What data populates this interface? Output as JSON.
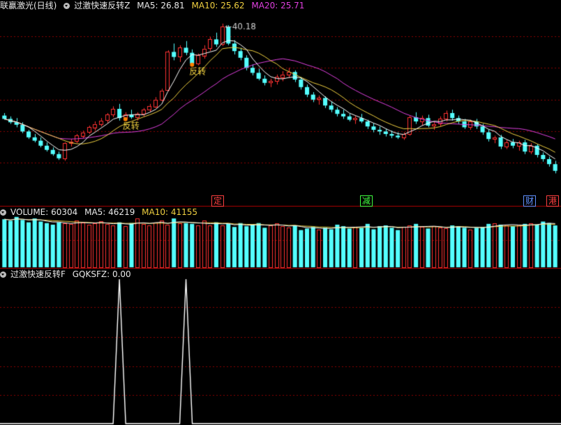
{
  "header": {
    "stock": "联赢激光(日线)",
    "indicator": "过激快速反转Z",
    "ma5": "MA5: 26.81",
    "ma10": "MA10: 25.62",
    "ma20": "MA20: 25.71"
  },
  "annotations": {
    "high": "40.18",
    "reversal1": "反转",
    "reversal2": "反转"
  },
  "event_tags": [
    {
      "label": "定",
      "color": "#ff4040"
    },
    {
      "label": "减",
      "color": "#40ff40"
    },
    {
      "label": "财",
      "color": "#6090ff"
    },
    {
      "label": "港",
      "color": "#ff4040"
    }
  ],
  "volume_header": {
    "volume": "VOLUME: 60304",
    "ma5": "MA5: 46219",
    "ma10": "MA10: 41155"
  },
  "osc_header": {
    "name": "过激快速反转F",
    "value": "GQKSFZ: 0.00"
  },
  "colors": {
    "up": "#ff3232",
    "down": "#54ffff",
    "ma5": "#ffffff",
    "ma10": "#f0d040",
    "ma20": "#e040e0",
    "grid": "#8b0000"
  },
  "chart_data": [
    {
      "type": "candlestick",
      "title": "联赢激光(日线)",
      "ylim": [
        20,
        41.5
      ],
      "high_label": 40.18,
      "ohlc": [
        [
          29.2,
          29.5,
          28.7,
          28.8
        ],
        [
          28.8,
          29.1,
          28.2,
          28.4
        ],
        [
          28.4,
          28.9,
          27.8,
          28.1
        ],
        [
          28.1,
          28.4,
          27.1,
          27.3
        ],
        [
          27.3,
          27.5,
          26.4,
          26.6
        ],
        [
          26.6,
          27.0,
          26.0,
          26.2
        ],
        [
          26.2,
          26.6,
          25.4,
          25.6
        ],
        [
          25.6,
          26.0,
          24.9,
          25.1
        ],
        [
          25.1,
          25.4,
          24.4,
          24.6
        ],
        [
          24.6,
          24.9,
          23.9,
          24.1
        ],
        [
          24.1,
          26.0,
          23.8,
          25.9
        ],
        [
          25.9,
          26.4,
          25.5,
          26.1
        ],
        [
          26.1,
          27.0,
          25.9,
          26.8
        ],
        [
          26.8,
          27.4,
          26.5,
          27.2
        ],
        [
          27.2,
          28.0,
          27.0,
          27.8
        ],
        [
          27.8,
          28.5,
          27.4,
          28.2
        ],
        [
          28.2,
          28.9,
          27.9,
          28.6
        ],
        [
          28.6,
          29.5,
          28.3,
          29.3
        ],
        [
          29.3,
          30.3,
          29.0,
          30.0
        ],
        [
          30.0,
          30.6,
          28.6,
          28.9
        ],
        [
          28.9,
          29.6,
          28.6,
          29.3
        ],
        [
          29.3,
          29.9,
          28.8,
          29.0
        ],
        [
          29.0,
          29.6,
          28.6,
          29.4
        ],
        [
          29.4,
          30.1,
          29.1,
          29.9
        ],
        [
          29.9,
          30.6,
          29.6,
          30.3
        ],
        [
          30.3,
          31.4,
          30.1,
          31.1
        ],
        [
          31.1,
          32.4,
          30.9,
          32.2
        ],
        [
          32.2,
          37.0,
          32.1,
          36.8
        ],
        [
          36.8,
          37.8,
          35.8,
          36.2
        ],
        [
          36.2,
          37.6,
          35.6,
          37.3
        ],
        [
          37.3,
          38.1,
          36.4,
          36.7
        ],
        [
          36.7,
          37.1,
          35.1,
          35.4
        ],
        [
          35.4,
          36.6,
          35.2,
          36.4
        ],
        [
          36.4,
          37.6,
          36.0,
          37.2
        ],
        [
          37.2,
          38.6,
          36.9,
          38.3
        ],
        [
          38.3,
          39.1,
          37.4,
          37.7
        ],
        [
          37.7,
          40.18,
          37.5,
          39.8
        ],
        [
          39.8,
          40.0,
          37.6,
          37.8
        ],
        [
          37.8,
          38.2,
          36.5,
          36.9
        ],
        [
          36.9,
          37.3,
          35.8,
          36.1
        ],
        [
          36.1,
          36.4,
          34.6,
          34.9
        ],
        [
          34.9,
          35.3,
          34.0,
          34.3
        ],
        [
          34.3,
          34.8,
          33.4,
          33.6
        ],
        [
          33.6,
          34.0,
          32.8,
          33.1
        ],
        [
          33.1,
          33.6,
          32.6,
          33.3
        ],
        [
          33.3,
          34.1,
          32.9,
          33.8
        ],
        [
          33.8,
          34.5,
          33.3,
          34.1
        ],
        [
          34.1,
          34.9,
          33.7,
          34.4
        ],
        [
          34.4,
          34.6,
          33.2,
          33.5
        ],
        [
          33.5,
          33.8,
          32.3,
          32.6
        ],
        [
          32.6,
          32.9,
          31.4,
          31.7
        ],
        [
          31.7,
          32.0,
          30.8,
          31.1
        ],
        [
          31.1,
          31.6,
          30.5,
          31.3
        ],
        [
          31.3,
          31.5,
          30.1,
          30.4
        ],
        [
          30.4,
          30.9,
          29.6,
          29.9
        ],
        [
          29.9,
          30.2,
          29.1,
          29.4
        ],
        [
          29.4,
          29.9,
          28.8,
          29.1
        ],
        [
          29.1,
          29.4,
          28.5,
          28.7
        ],
        [
          28.7,
          29.2,
          28.2,
          28.9
        ],
        [
          28.9,
          29.4,
          28.3,
          28.5
        ],
        [
          28.5,
          28.7,
          27.6,
          27.9
        ],
        [
          27.9,
          28.3,
          27.2,
          27.5
        ],
        [
          27.5,
          27.9,
          26.9,
          27.3
        ],
        [
          27.3,
          27.6,
          26.7,
          27.0
        ],
        [
          27.0,
          27.4,
          26.5,
          26.8
        ],
        [
          26.8,
          27.2,
          26.4,
          26.6
        ],
        [
          26.6,
          27.2,
          26.3,
          27.0
        ],
        [
          27.0,
          29.2,
          26.8,
          29.0
        ],
        [
          29.0,
          29.6,
          28.2,
          28.5
        ],
        [
          28.5,
          29.2,
          28.0,
          28.9
        ],
        [
          28.9,
          29.3,
          27.8,
          28.0
        ],
        [
          28.0,
          28.5,
          27.5,
          28.2
        ],
        [
          28.2,
          29.1,
          27.9,
          28.8
        ],
        [
          28.8,
          29.8,
          28.5,
          29.5
        ],
        [
          29.5,
          29.9,
          28.6,
          28.9
        ],
        [
          28.9,
          29.2,
          28.2,
          28.5
        ],
        [
          28.5,
          28.8,
          27.6,
          27.8
        ],
        [
          27.8,
          28.7,
          27.5,
          28.5
        ],
        [
          28.5,
          28.8,
          27.6,
          27.9
        ],
        [
          27.9,
          28.2,
          26.9,
          27.2
        ],
        [
          27.2,
          27.5,
          26.1,
          26.4
        ],
        [
          26.4,
          26.8,
          25.9,
          26.6
        ],
        [
          26.6,
          26.9,
          25.2,
          25.5
        ],
        [
          25.5,
          26.3,
          25.2,
          26.0
        ],
        [
          26.0,
          26.4,
          25.3,
          25.6
        ],
        [
          25.6,
          26.2,
          25.0,
          26.0
        ],
        [
          26.0,
          26.3,
          24.6,
          24.9
        ],
        [
          24.9,
          25.9,
          24.6,
          25.6
        ],
        [
          25.6,
          25.8,
          24.2,
          24.5
        ],
        [
          24.5,
          24.8,
          23.7,
          24.0
        ],
        [
          24.0,
          24.3,
          23.1,
          23.4
        ],
        [
          23.4,
          23.8,
          22.3,
          22.6
        ]
      ],
      "series": [
        {
          "name": "MA5",
          "last": 26.81
        },
        {
          "name": "MA10",
          "last": 25.62
        },
        {
          "name": "MA20",
          "last": 25.71
        }
      ],
      "markers": [
        {
          "index": 20,
          "label": "反转"
        },
        {
          "index": 31,
          "label": "反转"
        }
      ]
    },
    {
      "type": "bar",
      "title": "VOLUME",
      "ylim": [
        0,
        100
      ],
      "values": [
        35,
        33,
        38,
        34,
        31,
        36,
        32,
        30,
        28,
        31,
        30,
        29,
        33,
        31,
        28,
        30,
        32,
        29,
        27,
        31,
        26,
        30,
        36,
        29,
        27,
        31,
        33,
        28,
        36,
        30,
        30,
        29,
        27,
        33,
        27,
        31,
        27,
        29,
        25,
        30,
        26,
        28,
        30,
        24,
        27,
        30,
        26,
        24,
        27,
        21,
        23,
        25,
        22,
        24,
        22,
        28,
        26,
        23,
        25,
        24,
        29,
        22,
        26,
        27,
        24,
        21,
        25,
        27,
        29,
        25,
        23,
        26,
        24,
        23,
        27,
        26,
        24,
        22,
        24,
        25,
        29,
        30,
        28,
        27,
        26,
        27,
        29,
        30,
        28,
        32,
        30,
        27
      ]
    },
    {
      "type": "line",
      "title": "过激快速反转F",
      "ylim": [
        0,
        1
      ],
      "values_at_markers": [
        {
          "index": 20,
          "value": 1
        },
        {
          "index": 31,
          "value": 1
        }
      ],
      "last": 0.0
    }
  ]
}
